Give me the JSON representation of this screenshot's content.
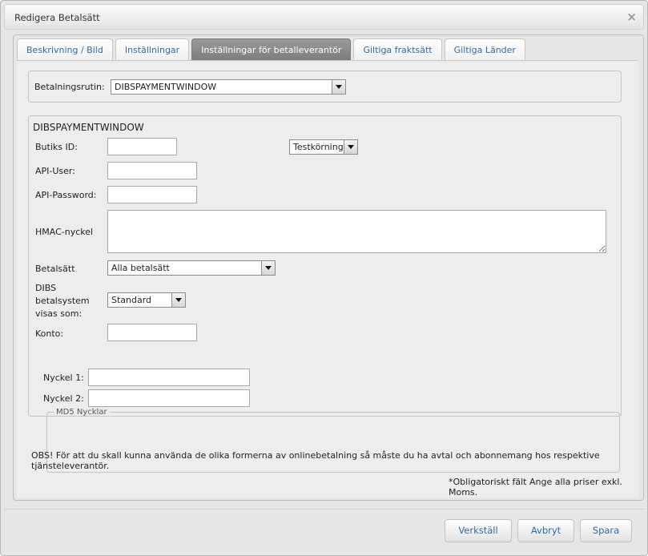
{
  "window": {
    "title": "Redigera Betalsätt",
    "close_glyph": "×"
  },
  "tabs": [
    {
      "label": "Beskrivning / Bild",
      "active": false
    },
    {
      "label": "Inställningar",
      "active": false
    },
    {
      "label": "Inställningar för betalleverantör",
      "active": true
    },
    {
      "label": "Giltiga fraktsätt",
      "active": false
    },
    {
      "label": "Giltiga Länder",
      "active": false
    }
  ],
  "routine": {
    "label": "Betalningsrutin:",
    "value": "DIBSPAYMENTWINDOW"
  },
  "section": {
    "heading": "DIBSPAYMENTWINDOW",
    "butiks_id": {
      "label": "Butiks ID:",
      "value": ""
    },
    "testmode": {
      "value": "Testkörning"
    },
    "api_user": {
      "label": "API-User:",
      "value": ""
    },
    "api_password": {
      "label": "API-Password:",
      "value": ""
    },
    "hmac": {
      "label": "HMAC-nyckel",
      "value": ""
    },
    "betalsatt": {
      "label": "Betalsätt",
      "value": "Alla betalsätt"
    },
    "dibs_display": {
      "label_lines": [
        "DIBS",
        "betalsystem",
        "visas som:"
      ],
      "value": "Standard"
    },
    "konto": {
      "label": "Konto:",
      "value": ""
    },
    "md5": {
      "legend": "MD5 Nycklar",
      "key1": {
        "label": "Nyckel 1:",
        "value": ""
      },
      "key2": {
        "label": "Nyckel 2:",
        "value": ""
      }
    }
  },
  "notice": "OBS! För att du skall kunna använda de olika formerna av onlinebetalning så måste du ha avtal och abonnemang hos respektive tjänsteleverantör.",
  "footnote": "*Obligatoriskt fält Ange alla priser exkl. Moms.",
  "buttons": {
    "apply": "Verkställ",
    "cancel": "Avbryt",
    "save": "Spara"
  },
  "colors": {
    "link": "#2e6ca4",
    "active_tab": "#8a8a8a",
    "panel": "#ededed"
  }
}
